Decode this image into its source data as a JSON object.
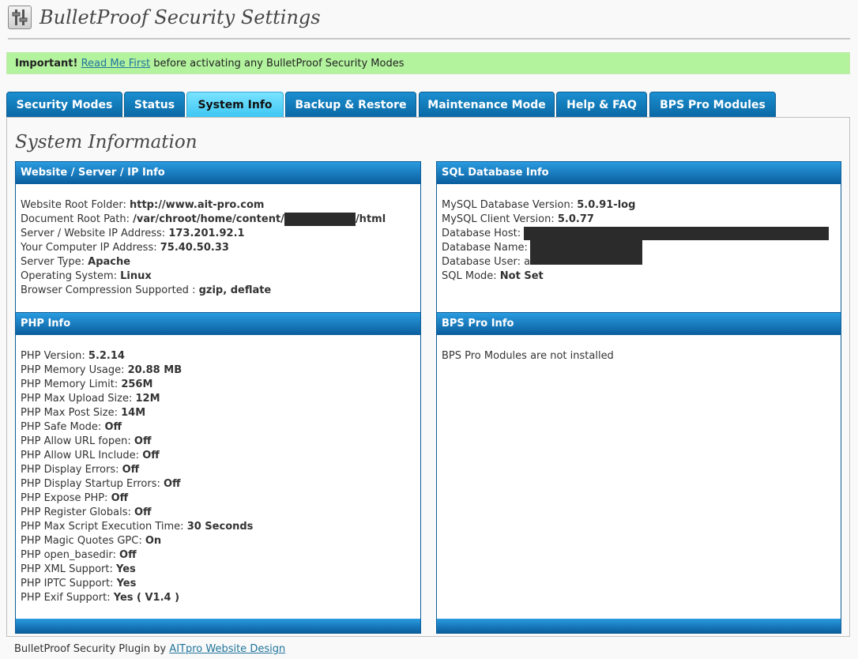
{
  "header": {
    "icon": "settings-sliders-icon",
    "title": "BulletProof Security Settings"
  },
  "notice": {
    "important": "Important!",
    "link": "Read Me First",
    "text": " before activating any BulletProof Security Modes",
    "background": "#b3f39e"
  },
  "tabs": [
    {
      "label": "Security Modes"
    },
    {
      "label": "Status"
    },
    {
      "label": "System Info",
      "active": true
    },
    {
      "label": "Backup & Restore"
    },
    {
      "label": "Maintenance Mode"
    },
    {
      "label": "Help & FAQ"
    },
    {
      "label": "BPS Pro Modules"
    }
  ],
  "page_title": "System Information",
  "panels": {
    "website": {
      "title": "Website / Server / IP Info",
      "rows": [
        {
          "label": "Website Root Folder: ",
          "value": "http://www.ait-pro.com"
        },
        {
          "label": "Document Root Path: ",
          "value": "/var/chroot/home/content/",
          "value_after": "/html",
          "redacted": true
        },
        {
          "label": "Server / Website IP Address: ",
          "value": "173.201.92.1"
        },
        {
          "label": "Your Computer IP Address: ",
          "value": "75.40.50.33"
        },
        {
          "label": "Server Type: ",
          "value": "Apache"
        },
        {
          "label": "Operating System: ",
          "value": "Linux"
        },
        {
          "label": "Browser Compression Supported : ",
          "value": "gzip, deflate"
        }
      ]
    },
    "sql": {
      "title": "SQL Database Info",
      "rows": [
        {
          "label": "MySQL Database Version: ",
          "value": "5.0.91-log"
        },
        {
          "label": "MySQL Client Version: ",
          "value": "5.0.77"
        },
        {
          "label": "Database Host: ",
          "value": "",
          "redacted": true
        },
        {
          "label": "Database Name: ",
          "value": "",
          "redacted": true
        },
        {
          "label": "Database User: a",
          "value": "",
          "redacted": true
        },
        {
          "label": "SQL Mode: ",
          "value": "Not Set"
        }
      ]
    },
    "php": {
      "title": "PHP Info",
      "rows": [
        {
          "label": "PHP Version: ",
          "value": "5.2.14"
        },
        {
          "label": "PHP Memory Usage: ",
          "value": "20.88 MB"
        },
        {
          "label": "PHP Memory Limit: ",
          "value": "256M"
        },
        {
          "label": "PHP Max Upload Size: ",
          "value": "12M"
        },
        {
          "label": "PHP Max Post Size: ",
          "value": "14M"
        },
        {
          "label": "PHP Safe Mode: ",
          "value": "Off"
        },
        {
          "label": "PHP Allow URL fopen: ",
          "value": "Off"
        },
        {
          "label": "PHP Allow URL Include: ",
          "value": "Off"
        },
        {
          "label": "PHP Display Errors: ",
          "value": "Off"
        },
        {
          "label": "PHP Display Startup Errors: ",
          "value": "Off"
        },
        {
          "label": "PHP Expose PHP: ",
          "value": "Off"
        },
        {
          "label": "PHP Register Globals: ",
          "value": "Off"
        },
        {
          "label": "PHP Max Script Execution Time: ",
          "value": "30 Seconds"
        },
        {
          "label": "PHP Magic Quotes GPC: ",
          "value": "On"
        },
        {
          "label": "PHP open_basedir: ",
          "value": "Off"
        },
        {
          "label": "PHP XML Support: ",
          "value": "Yes"
        },
        {
          "label": "PHP IPTC Support: ",
          "value": "Yes"
        },
        {
          "label": "PHP Exif Support: ",
          "value": "Yes ( V1.4 )"
        }
      ]
    },
    "bpspro": {
      "title": "BPS Pro Info",
      "text": "BPS Pro Modules are not installed"
    }
  },
  "footer": {
    "text": "BulletProof Security Plugin by ",
    "link": "AITpro Website Design"
  }
}
